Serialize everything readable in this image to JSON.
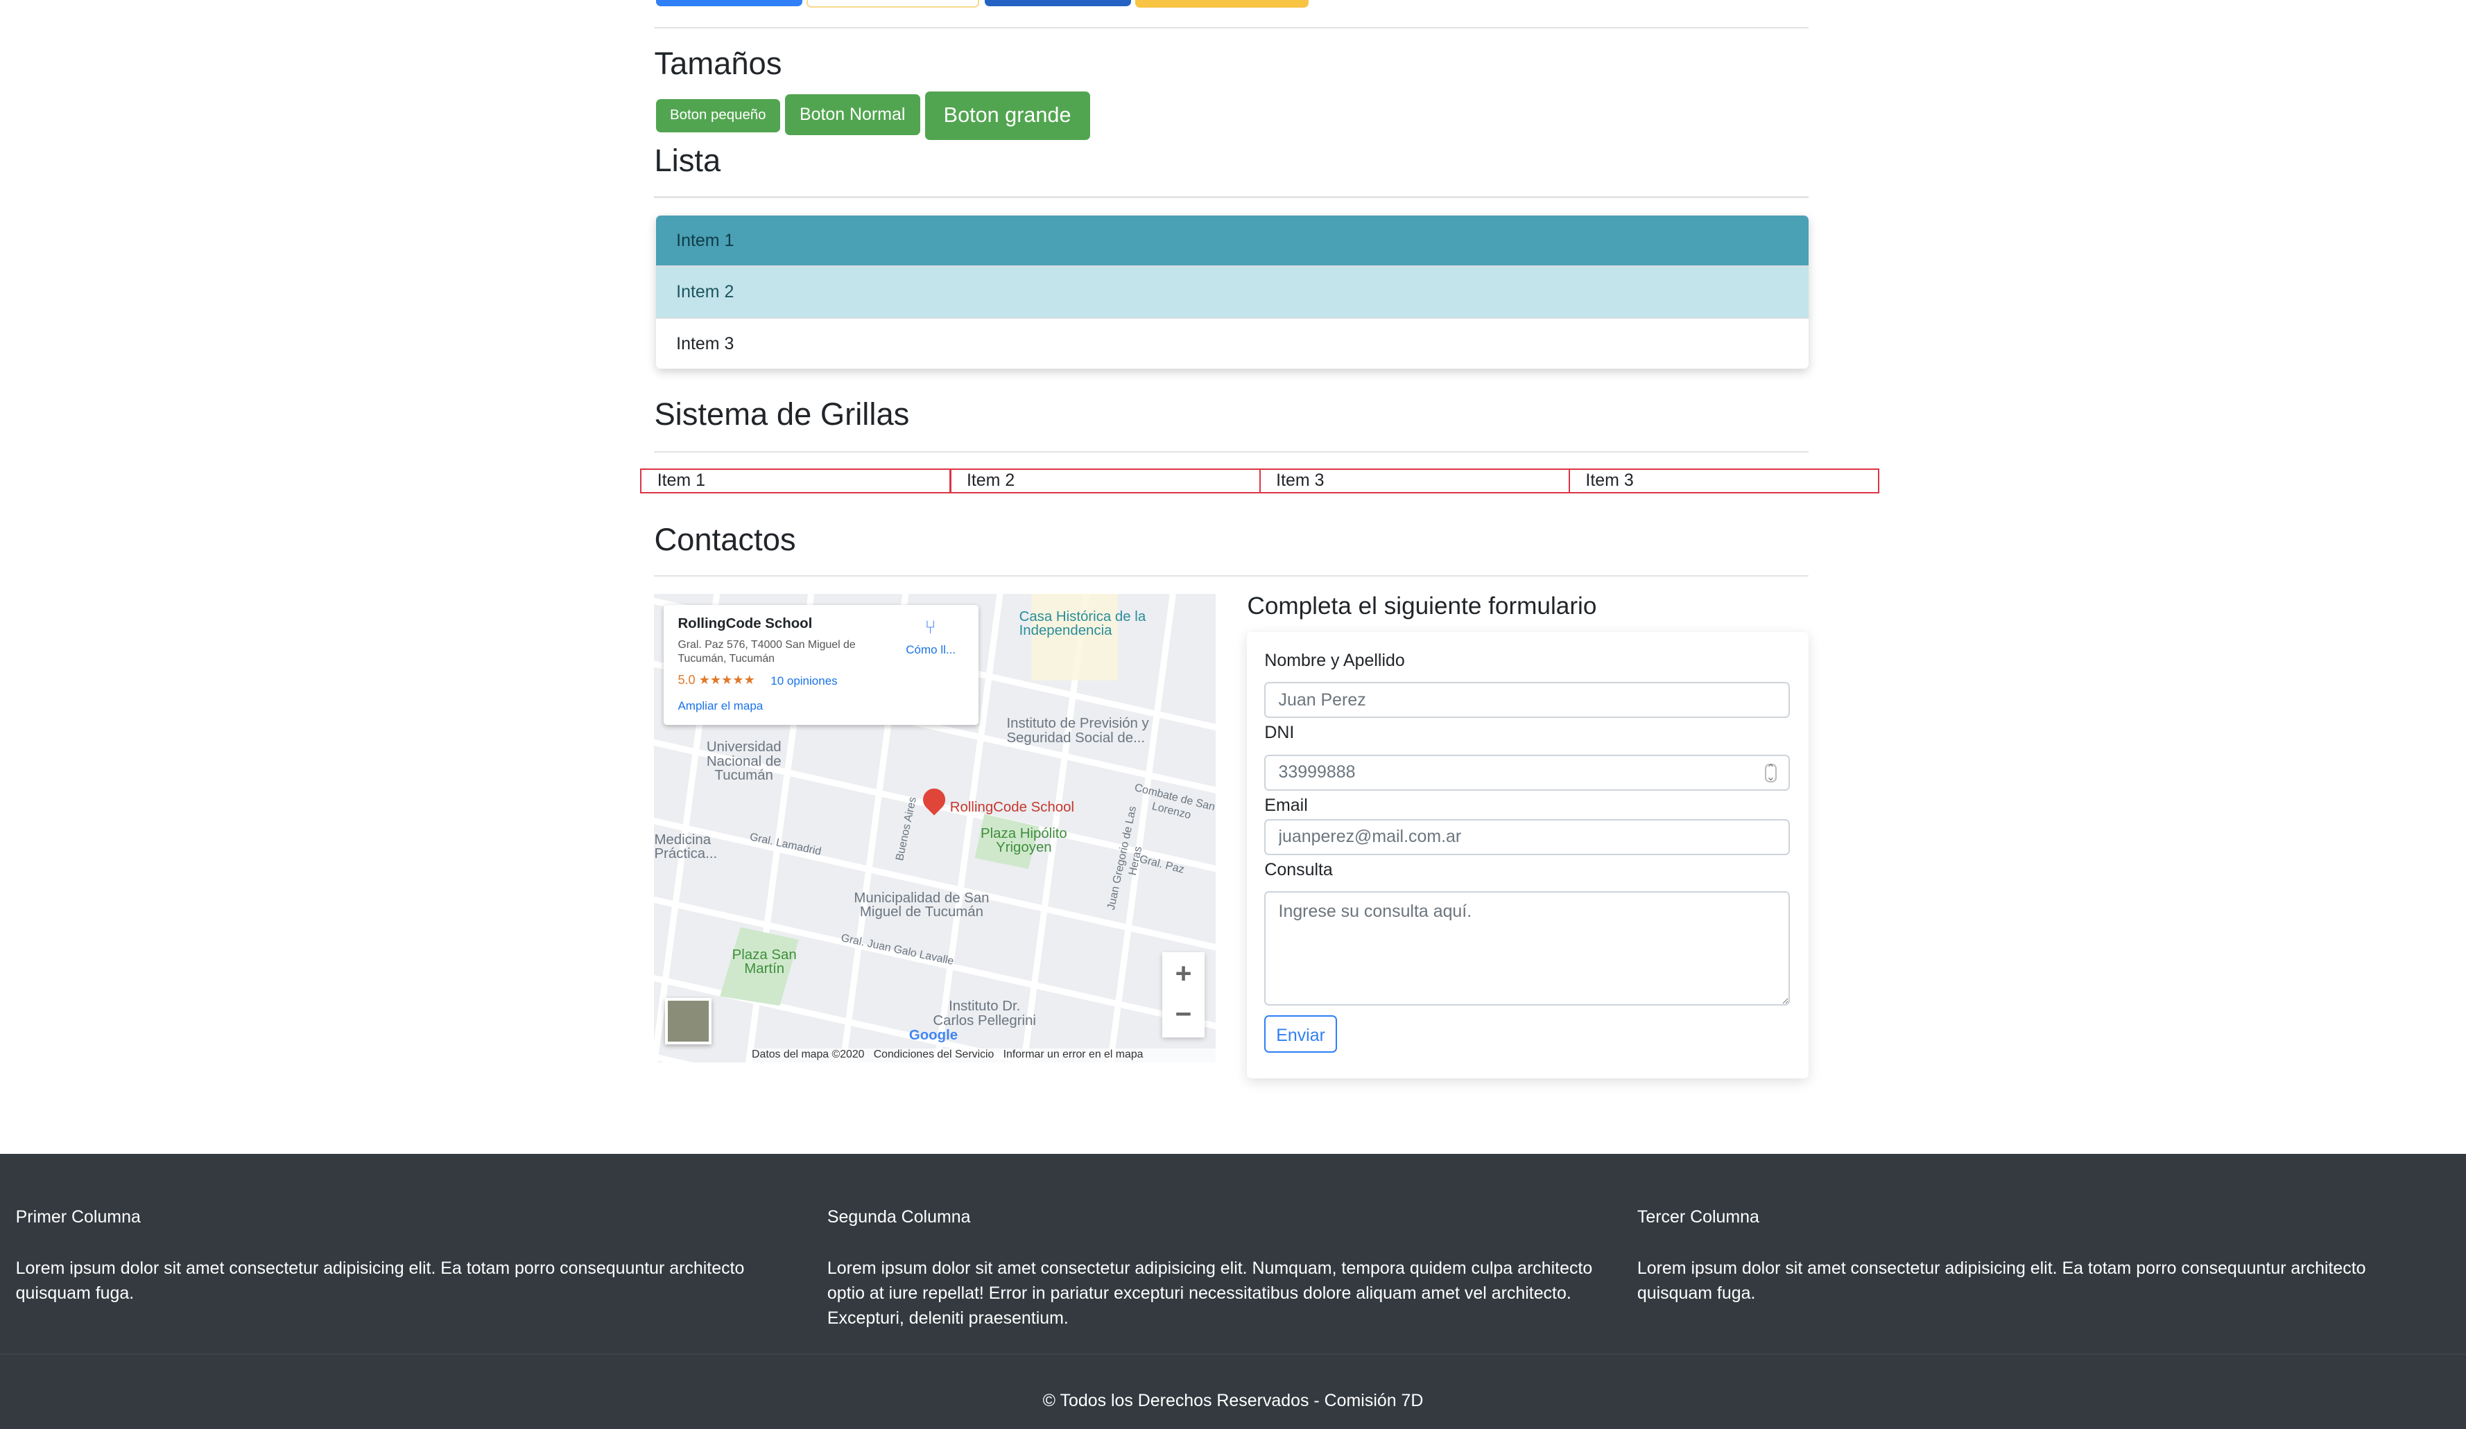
{
  "colors": {
    "primary": "#2f7ff6",
    "warning": "#f7c444",
    "success": "#52a550",
    "info": "#4aa0b5",
    "info_light": "#c3e4ea",
    "danger": "#dc3545",
    "footer": "#343a40"
  },
  "sizes": {
    "title": "Tamaños",
    "small": "Boton pequeño",
    "normal": "Boton Normal",
    "large": "Boton grande"
  },
  "list": {
    "title": "Lista",
    "items": [
      "Intem 1",
      "Intem 2",
      "Intem 3"
    ]
  },
  "grid": {
    "title": "Sistema de Grillas",
    "items": [
      "Item 1",
      "Item 2",
      "Item 3",
      "Item 3"
    ]
  },
  "contact": {
    "title": "Contactos",
    "map": {
      "place": "RollingCode School",
      "address": "Gral. Paz 576, T4000 San Miguel de Tucumán, Tucumán",
      "rating": "5.0",
      "stars": "★★★★★",
      "reviews": "10 opiniones",
      "directions": "Cómo ll...",
      "expand": "Ampliar el mapa",
      "labels": [
        "Casa Histórica de la Independencia",
        "Instituto de Previsión y Seguridad Social de...",
        "Universidad Nacional de Tucumán",
        "Medicina Práctica...",
        "Plaza Hipólito Yrigoyen",
        "Municipalidad de San Miguel de Tucumán",
        "Plaza San Martín",
        "Instituto Dr. Carlos Pellegrini",
        "Gral. Lamadrid",
        "Buenos Aires",
        "Gral. Juan Galo Lavalle",
        "Gral. Paz",
        "Juan Gregorio de Las Heras",
        "Combate de San Lorenzo"
      ],
      "pin_label": "RollingCode School",
      "google": "Google",
      "footer": [
        "Datos del mapa ©2020",
        "Condiciones del Servicio",
        "Informar un error en el mapa"
      ]
    },
    "form": {
      "title": "Completa el siguiente formulario",
      "name_label": "Nombre y Apellido",
      "name_placeholder": "Juan Perez",
      "dni_label": "DNI",
      "dni_placeholder": "33999888",
      "email_label": "Email",
      "email_placeholder": "juanperez@mail.com.ar",
      "query_label": "Consulta",
      "query_placeholder": "Ingrese su consulta aquí.",
      "submit": "Enviar"
    }
  },
  "footer": {
    "columns": [
      {
        "title": "Primer Columna",
        "text": "Lorem ipsum dolor sit amet consectetur adipisicing elit. Ea totam porro consequuntur architecto quisquam fuga."
      },
      {
        "title": "Segunda Columna",
        "text": "Lorem ipsum dolor sit amet consectetur adipisicing elit. Numquam, tempora quidem culpa architecto optio at iure repellat! Error in pariatur excepturi necessitatibus dolore aliquam amet vel architecto. Excepturi, deleniti praesentium."
      },
      {
        "title": "Tercer Columna",
        "text": "Lorem ipsum dolor sit amet consectetur adipisicing elit. Ea totam porro consequuntur architecto quisquam fuga."
      }
    ],
    "copyright": "© Todos los Derechos Reservados - Comisión 7D"
  }
}
